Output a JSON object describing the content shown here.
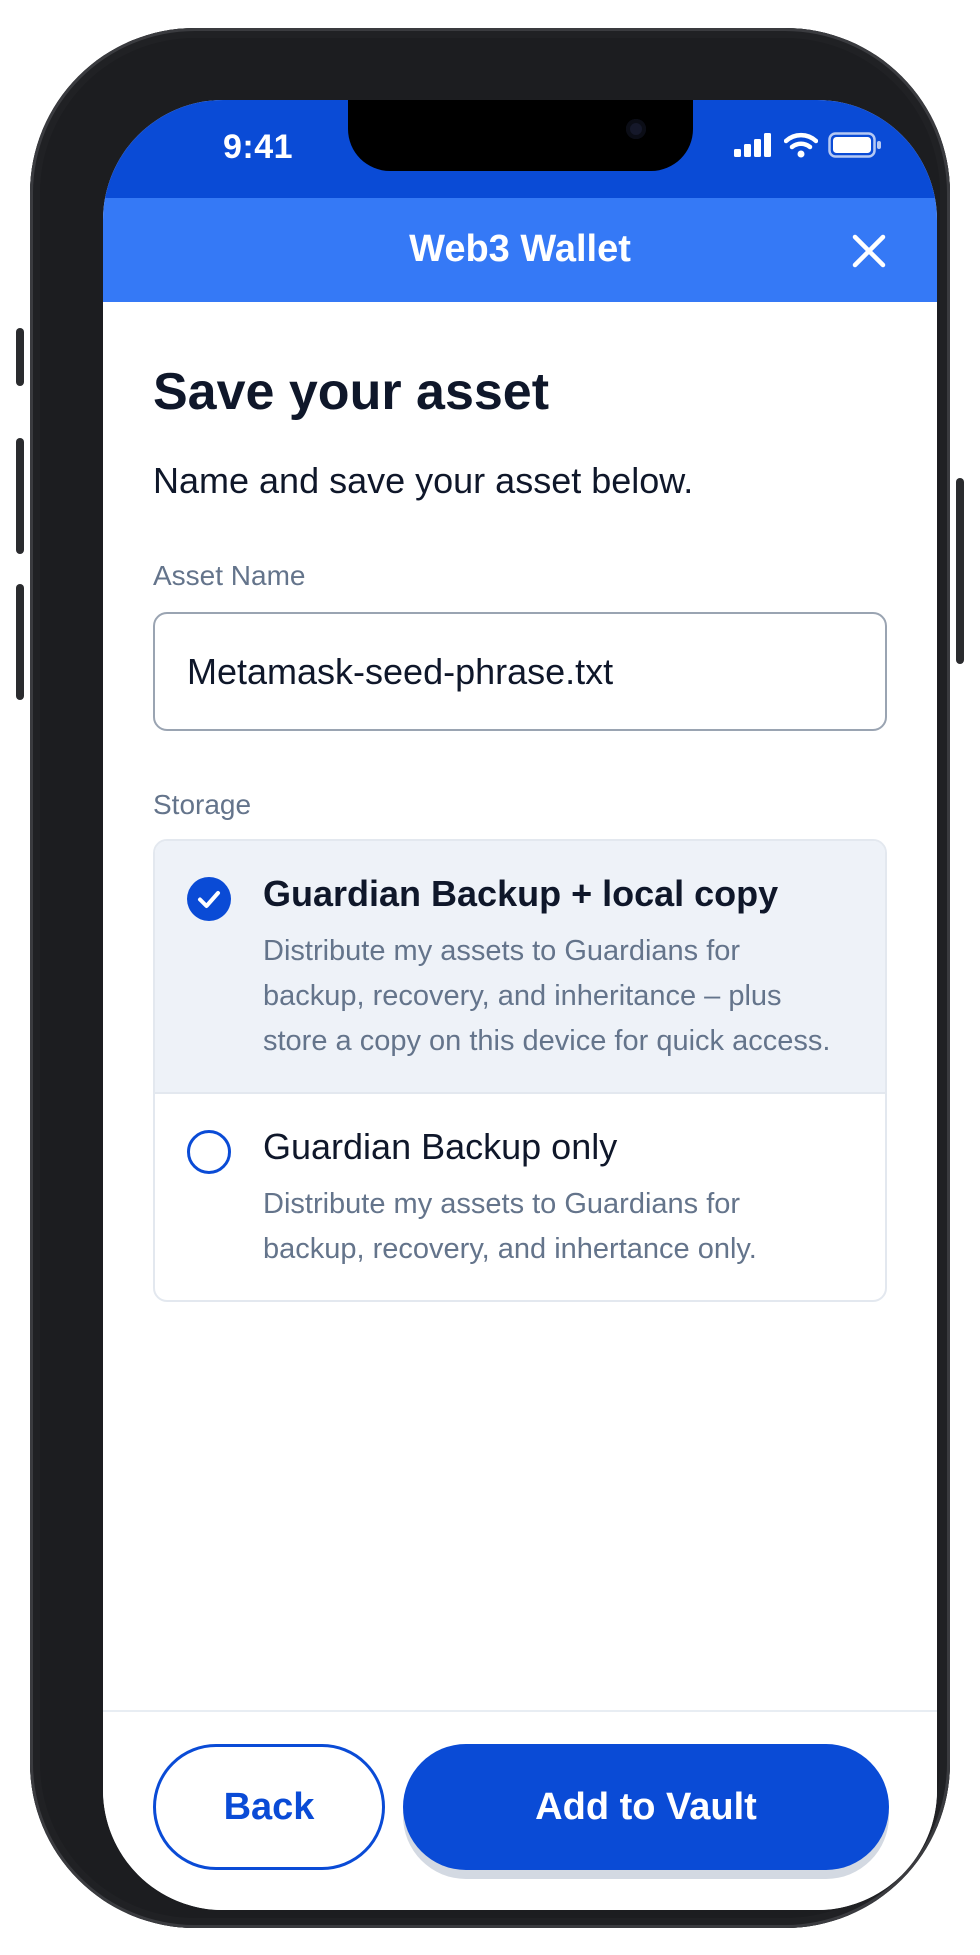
{
  "status_bar": {
    "time": "9:41",
    "icons": [
      "signal-icon",
      "wifi-icon",
      "battery-icon"
    ]
  },
  "header": {
    "title": "Web3 Wallet",
    "close_icon": "close-icon"
  },
  "main": {
    "title": "Save your asset",
    "subtitle": "Name and save your asset below.",
    "asset_name_label": "Asset Name",
    "asset_name_value": "Metamask-seed-phrase.txt",
    "storage_label": "Storage",
    "options": [
      {
        "title": "Guardian Backup + local copy",
        "description": "Distribute my assets to Guardians for backup, recovery, and inheritance – plus store a copy on this device for quick access.",
        "selected": true
      },
      {
        "title": "Guardian Backup only",
        "description": "Distribute my assets to Guardians for backup, recovery, and inhertance only.",
        "selected": false
      }
    ]
  },
  "footer": {
    "back_label": "Back",
    "add_label": "Add to Vault"
  },
  "colors": {
    "primary": "#0a4bd6",
    "header": "#3579f6",
    "text": "#0f172a",
    "muted": "#64748b",
    "selected_bg": "#eef2f8"
  }
}
